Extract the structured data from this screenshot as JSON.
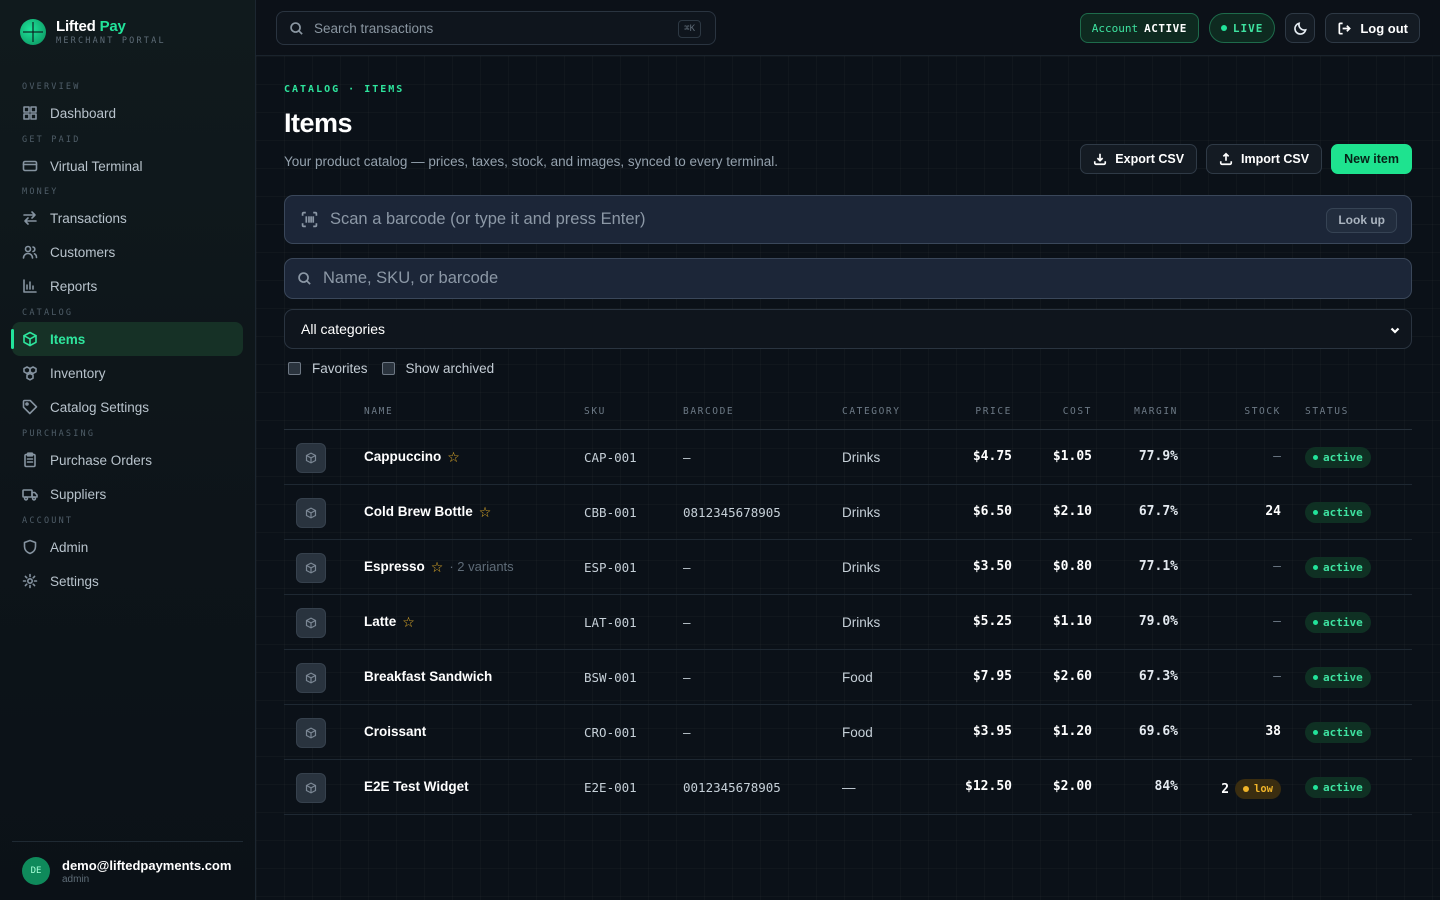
{
  "brand": {
    "name_a": "Lifted",
    "name_b": "Pay",
    "sub": "MERCHANT PORTAL"
  },
  "nav": {
    "sections": {
      "overview": "OVERVIEW",
      "get_paid": "GET PAID",
      "money": "MONEY",
      "catalog": "CATALOG",
      "purchasing": "PURCHASING",
      "account": "ACCOUNT"
    },
    "items": {
      "dashboard": "Dashboard",
      "virtual_terminal": "Virtual Terminal",
      "transactions": "Transactions",
      "customers": "Customers",
      "reports": "Reports",
      "items": "Items",
      "inventory": "Inventory",
      "catalog_settings": "Catalog Settings",
      "purchase_orders": "Purchase Orders",
      "suppliers": "Suppliers",
      "admin": "Admin",
      "settings": "Settings"
    },
    "active": "items"
  },
  "user": {
    "initials": "DE",
    "email": "demo@liftedpayments.com",
    "role": "admin"
  },
  "topbar": {
    "search_placeholder": "Search transactions",
    "shortcut": "⌘K",
    "account_label": "Account",
    "account_status": "ACTIVE",
    "live_label": "LIVE",
    "logout_label": "Log out"
  },
  "page": {
    "breadcrumb": "CATALOG · ITEMS",
    "title": "Items",
    "subtitle": "Your product catalog — prices, taxes, stock, and images, synced to every terminal.",
    "export_label": "Export CSV",
    "import_label": "Import CSV",
    "new_label": "New item",
    "scan_placeholder": "Scan a barcode (or type it and press Enter)",
    "lookup_label": "Look up",
    "filter_placeholder": "Name, SKU, or barcode",
    "category_selected": "All categories",
    "favorites_label": "Favorites",
    "archived_label": "Show archived"
  },
  "table": {
    "headers": {
      "name": "NAME",
      "sku": "SKU",
      "barcode": "BARCODE",
      "category": "CATEGORY",
      "price": "PRICE",
      "cost": "COST",
      "margin": "MARGIN",
      "stock": "STOCK",
      "status": "STATUS"
    },
    "rows": [
      {
        "name": "Cappuccino",
        "favorite": true,
        "variants": "",
        "sku": "CAP-001",
        "barcode": "—",
        "category": "Drinks",
        "price": "$4.75",
        "cost": "$1.05",
        "margin": "77.9%",
        "stock": "—",
        "low": "",
        "status": "active"
      },
      {
        "name": "Cold Brew Bottle",
        "favorite": true,
        "variants": "",
        "sku": "CBB-001",
        "barcode": "0812345678905",
        "category": "Drinks",
        "price": "$6.50",
        "cost": "$2.10",
        "margin": "67.7%",
        "stock": "24",
        "low": "",
        "status": "active"
      },
      {
        "name": "Espresso",
        "favorite": true,
        "variants": "· 2 variants",
        "sku": "ESP-001",
        "barcode": "—",
        "category": "Drinks",
        "price": "$3.50",
        "cost": "$0.80",
        "margin": "77.1%",
        "stock": "—",
        "low": "",
        "status": "active"
      },
      {
        "name": "Latte",
        "favorite": true,
        "variants": "",
        "sku": "LAT-001",
        "barcode": "—",
        "category": "Drinks",
        "price": "$5.25",
        "cost": "$1.10",
        "margin": "79.0%",
        "stock": "—",
        "low": "",
        "status": "active"
      },
      {
        "name": "Breakfast Sandwich",
        "favorite": false,
        "variants": "",
        "sku": "BSW-001",
        "barcode": "—",
        "category": "Food",
        "price": "$7.95",
        "cost": "$2.60",
        "margin": "67.3%",
        "stock": "—",
        "low": "",
        "status": "active"
      },
      {
        "name": "Croissant",
        "favorite": false,
        "variants": "",
        "sku": "CRO-001",
        "barcode": "—",
        "category": "Food",
        "price": "$3.95",
        "cost": "$1.20",
        "margin": "69.6%",
        "stock": "38",
        "low": "",
        "status": "active"
      },
      {
        "name": "E2E Test Widget",
        "favorite": false,
        "variants": "",
        "sku": "E2E-001",
        "barcode": "0012345678905",
        "category": "—",
        "price": "$12.50",
        "cost": "$2.00",
        "margin": "84%",
        "stock": "2",
        "low": "low",
        "status": "active"
      }
    ]
  },
  "colors": {
    "accent": "#22e39a",
    "background": "#0b1118",
    "warning": "#f0b429"
  }
}
